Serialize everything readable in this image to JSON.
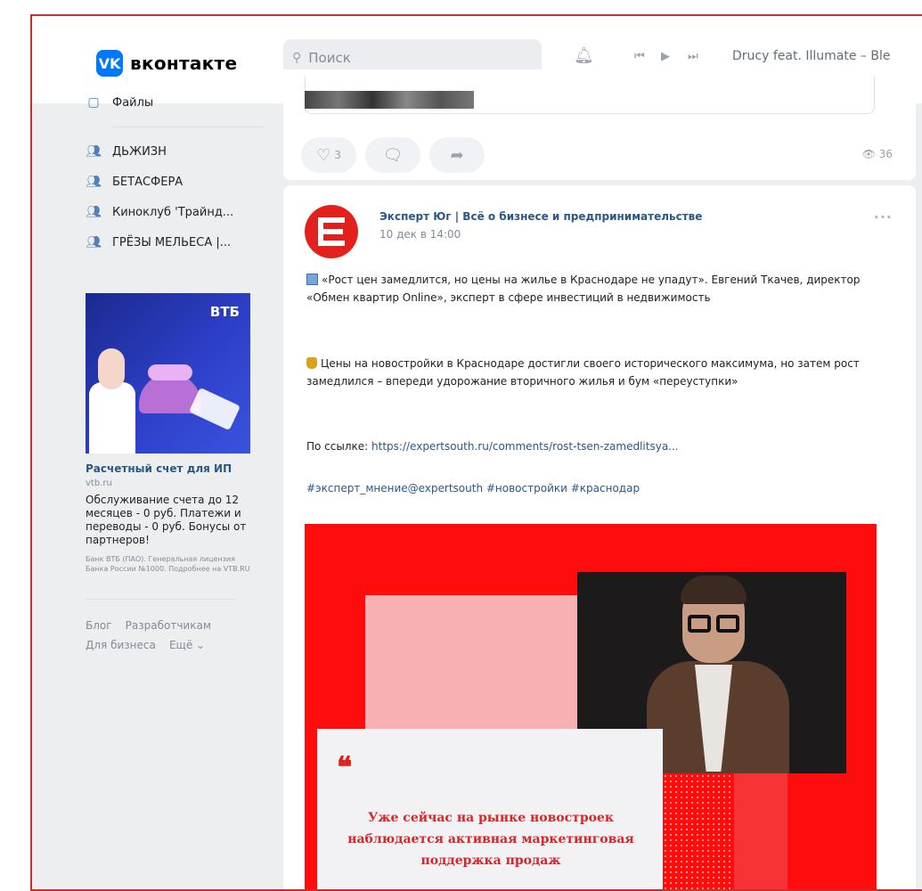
{
  "header": {
    "logo_mark": "VK",
    "logo_text": "вконтакте",
    "search_placeholder": "Поиск",
    "player_track": "Drucy feat. Illumate – Ble"
  },
  "sidebar": {
    "items": [
      {
        "label": "Файлы",
        "icon": "file-icon"
      },
      {
        "label": "ДЬЖИЗН",
        "icon": "group-icon"
      },
      {
        "label": "БЕТАСФЕРА",
        "icon": "group-icon"
      },
      {
        "label": "Киноклуб 'Трайнд...",
        "icon": "group-icon"
      },
      {
        "label": "ГРЁЗЫ МЕЛЬЕСА |...",
        "icon": "group-icon"
      }
    ],
    "ad": {
      "brand": "ВТБ",
      "title": "Расчетный счет для ИП",
      "domain": "vtb.ru",
      "description": "Обслуживание счета до 12 месяцев - 0 руб. Платежи и переводы - 0 руб. Бонусы от партнеров!",
      "legal": "Банк ВТБ (ПАО). Генеральная лицензия Банка России №1000. Подробнее на VTB.RU"
    },
    "footer": {
      "blog": "Блог",
      "developers": "Разработчикам",
      "business": "Для бизнеса",
      "more": "Ещё ⌄"
    }
  },
  "prev_post": {
    "likes": "3",
    "views": "36"
  },
  "post": {
    "author": "Эксперт Юг | Всё о бизнесе и предпринимательстве",
    "date": "10 дек в 14:00",
    "more": "···",
    "para1": "«Рост цен замедлится, но цены на жилье в Краснодаре не упадут». Евгений Ткачев, директор «Обмен квартир Online», эксперт в сфере инвестиций в недвижимость",
    "para2": "Цены на новостройки в Краснодаре достигли своего исторического максимума, но затем рост замедлился – впереди удорожание вторичного жилья и бум «переуступки»",
    "link_label": "По ссылке:",
    "link_url": "https://expertsouth.ru/comments/rost-tsen-zamedlitsya...",
    "hashtags": "#эксперт_мнение@expertsouth #новостройки #краснодар",
    "image_quote_mark": "❝",
    "image_quote": "Уже сейчас на рынке новостроек наблюдается активная маркетинговая поддержка продаж"
  },
  "colors": {
    "vk_blue": "#0077ff",
    "link": "#2a5885",
    "brand_red": "#e3201b",
    "frame_border": "#c9302c"
  }
}
